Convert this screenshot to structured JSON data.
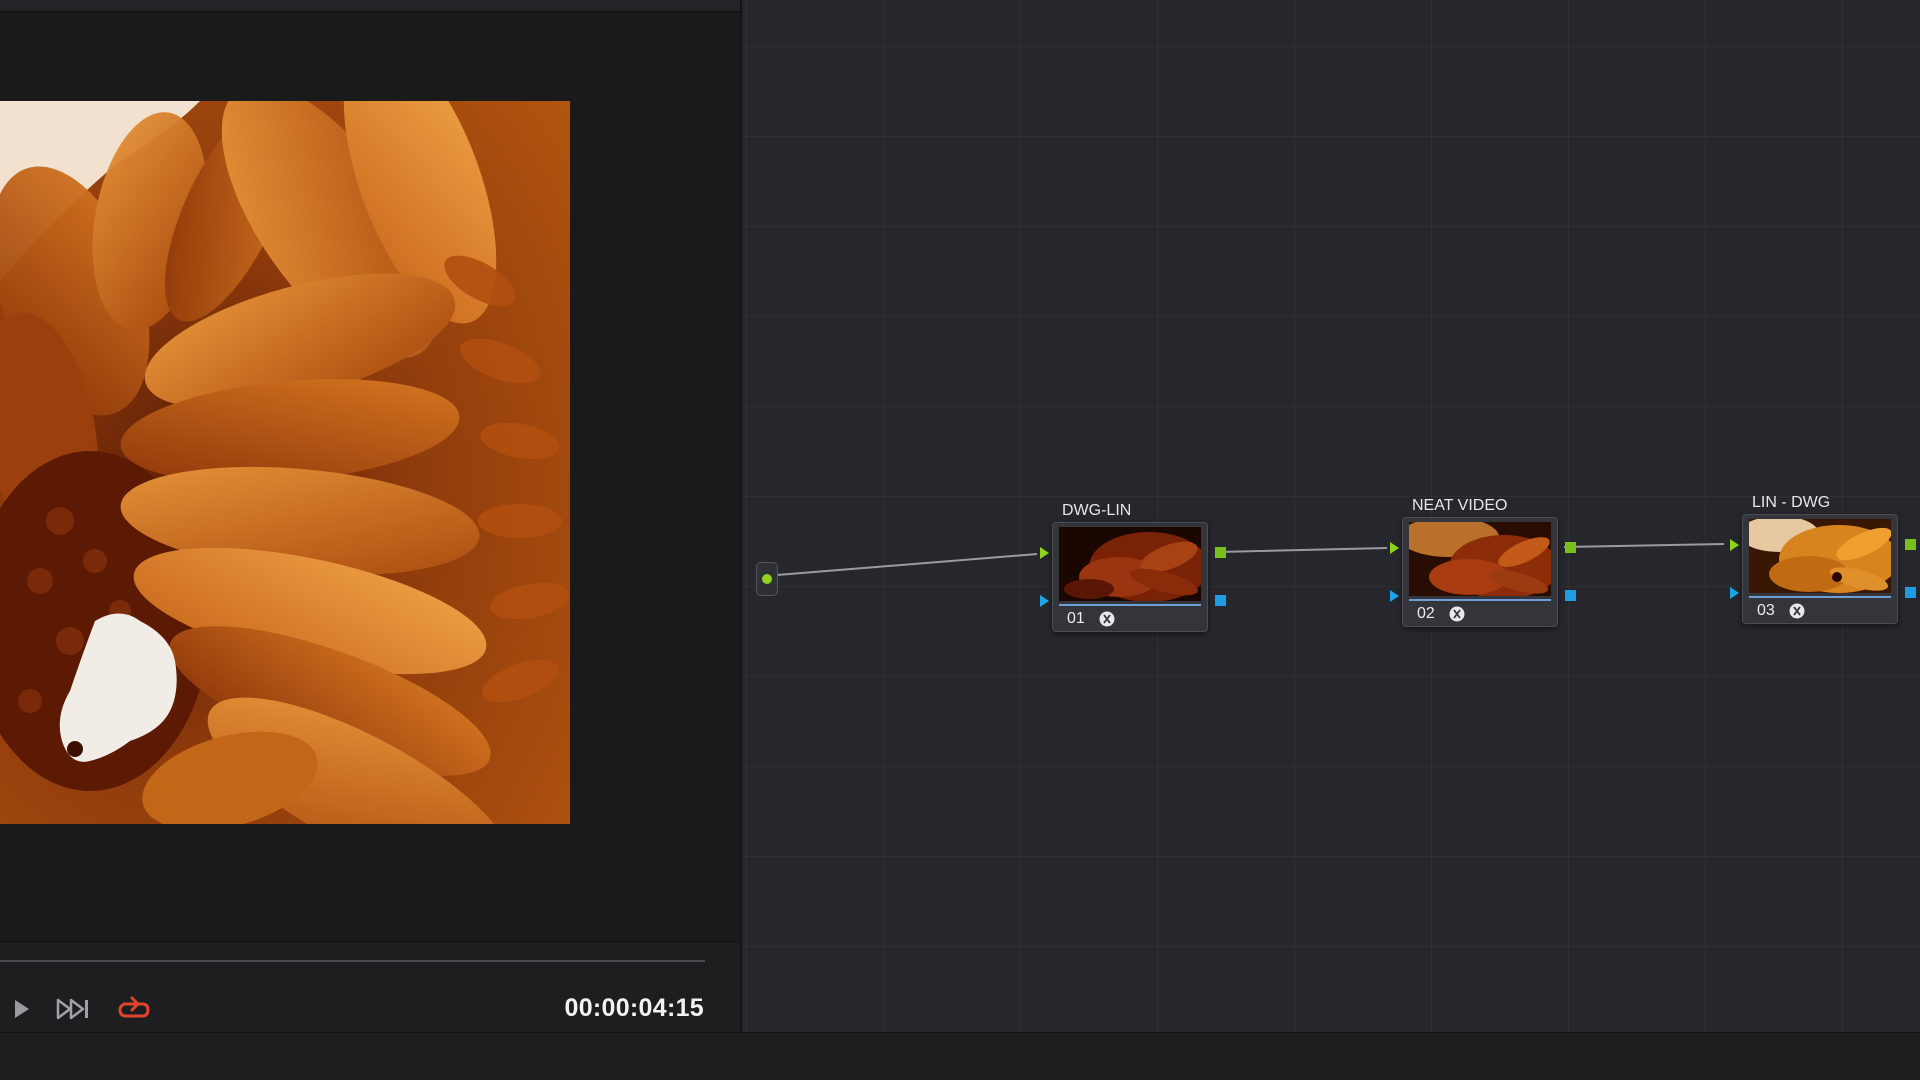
{
  "viewer": {
    "timecode": "00:00:04:15",
    "image_subject": "orange gerbera flower close-up"
  },
  "transport": {
    "play_icon": "play-icon",
    "next_icon": "skip-to-end-icon",
    "loop_icon": "loop-icon",
    "loop_color": "#e0442f"
  },
  "node_graph": {
    "nodes": [
      {
        "label": "DWG-LIN",
        "number": "01",
        "fx_icon": "fx-icon"
      },
      {
        "label": "NEAT VIDEO",
        "number": "02",
        "fx_icon": "fx-icon"
      },
      {
        "label": "LIN - DWG",
        "number": "03",
        "fx_icon": "fx-icon"
      }
    ],
    "colors": {
      "rgb_port": "#8fd31a",
      "alpha_port": "#21a3e8",
      "node_underline": "#6e9fd6",
      "background": "#26272c"
    }
  }
}
